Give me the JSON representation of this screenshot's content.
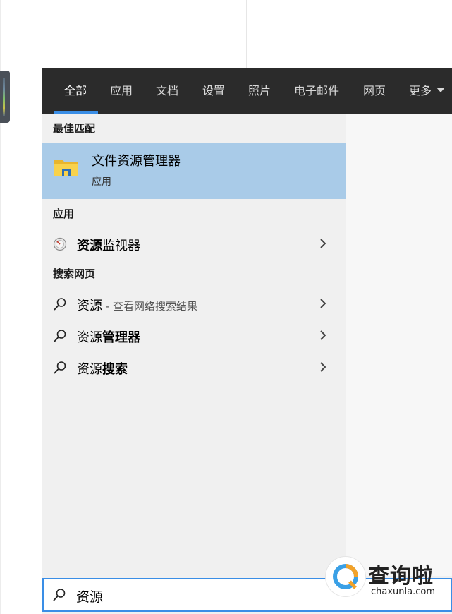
{
  "tabs": [
    {
      "label": "全部",
      "active": true
    },
    {
      "label": "应用"
    },
    {
      "label": "文档"
    },
    {
      "label": "设置"
    },
    {
      "label": "照片"
    },
    {
      "label": "电子邮件"
    },
    {
      "label": "网页"
    },
    {
      "label": "更多"
    }
  ],
  "sections": {
    "best_match": "最佳匹配",
    "apps": "应用",
    "web": "搜索网页"
  },
  "best_match": {
    "title": "文件资源管理器",
    "subtitle": "应用",
    "icon": "folder-icon"
  },
  "app_results": [
    {
      "bold": "资源",
      "rest": "监视器",
      "icon": "resource-monitor-icon"
    }
  ],
  "web_results": [
    {
      "plain": "资源",
      "hint": " - 查看网络搜索结果",
      "bold": "",
      "icon": "search-icon"
    },
    {
      "plain": "资源",
      "hint": "",
      "bold": "管理器",
      "icon": "search-icon"
    },
    {
      "plain": "资源",
      "hint": "",
      "bold": "搜索",
      "icon": "search-icon"
    }
  ],
  "search": {
    "value": "资源",
    "icon": "search-icon"
  },
  "watermark": {
    "text": "查询啦",
    "url": "chaxunla.com"
  },
  "colors": {
    "topbar": "#2b2b2b",
    "accent": "#3a8ee6",
    "highlight": "#a9cbe8",
    "panel": "#f0f0f0"
  }
}
